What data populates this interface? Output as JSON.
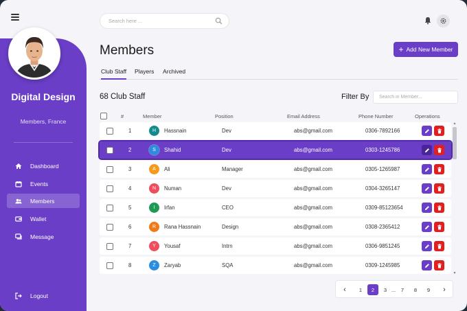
{
  "header": {
    "search_placeholder": "Search here ...",
    "title": "Members",
    "add_button_label": "Add New Member"
  },
  "sidebar": {
    "brand": "Digital Design",
    "subtitle": "Members, France",
    "items": [
      {
        "label": "Dashboard",
        "icon": "home-icon",
        "active": false
      },
      {
        "label": "Events",
        "icon": "calendar-icon",
        "active": false
      },
      {
        "label": "Members",
        "icon": "members-icon",
        "active": true
      },
      {
        "label": "Wallet",
        "icon": "wallet-icon",
        "active": false
      },
      {
        "label": "Message",
        "icon": "message-icon",
        "active": false
      }
    ],
    "logout_label": "Logout"
  },
  "tabs": [
    {
      "label": "Club Staff",
      "active": true
    },
    {
      "label": "Players",
      "active": false
    },
    {
      "label": "Archived",
      "active": false
    }
  ],
  "content": {
    "count_label": "68 Club Staff",
    "filter_label": "Filter By",
    "filter_placeholder": "Search in Member..."
  },
  "table": {
    "columns": [
      "#",
      "Member",
      "Position",
      "Email Address",
      "Phone Number",
      "Operations"
    ],
    "rows": [
      {
        "num": "1",
        "initial": "H",
        "name": "Hassnain",
        "position": "Dev",
        "email": "abs@gmail.com",
        "phone": "0306-7892166",
        "color": "#138a8e",
        "selected": false
      },
      {
        "num": "2",
        "initial": "S",
        "name": "Shahid",
        "position": "Dev",
        "email": "abs@gmail.com",
        "phone": "0303-1245786",
        "color": "#2a8de0",
        "selected": true
      },
      {
        "num": "3",
        "initial": "A",
        "name": "Ali",
        "position": "Manager",
        "email": "abs@gmail.com",
        "phone": "0305-1265987",
        "color": "#f59a1b",
        "selected": false
      },
      {
        "num": "4",
        "initial": "N",
        "name": "Numan",
        "position": "Dev",
        "email": "abs@gmail.com",
        "phone": "0304-3265147",
        "color": "#ef4d5d",
        "selected": false
      },
      {
        "num": "5",
        "initial": "I",
        "name": "Irfan",
        "position": "CEO",
        "email": "abs@gmail.com",
        "phone": "0309-85123654",
        "color": "#1f9a56",
        "selected": false
      },
      {
        "num": "6",
        "initial": "R",
        "name": "Rana Hassnain",
        "position": "Design",
        "email": "abs@gmail.com",
        "phone": "0308-2365412",
        "color": "#f07a1a",
        "selected": false
      },
      {
        "num": "7",
        "initial": "Y",
        "name": "Yousaf",
        "position": "Intrn",
        "email": "abs@gmail.com",
        "phone": "0306-9851245",
        "color": "#ef4d5d",
        "selected": false
      },
      {
        "num": "8",
        "initial": "Z",
        "name": "Zaryab",
        "position": "SQA",
        "email": "abs@gmail.com",
        "phone": "0309-1245985",
        "color": "#2a8de0",
        "selected": false
      }
    ]
  },
  "pagination": {
    "prev": "‹",
    "next": "›",
    "pages": [
      "1",
      "2",
      "3",
      "...",
      "7",
      "8",
      "9"
    ],
    "active": "2"
  },
  "colors": {
    "accent": "#6a3ec6",
    "danger": "#e02020"
  }
}
